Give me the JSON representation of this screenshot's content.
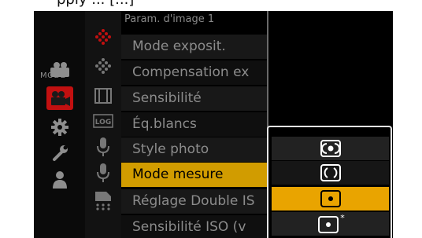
{
  "top_strip_text": "pply ... [...]",
  "menu": {
    "header": "Param. d'image 1",
    "items": [
      {
        "label": "Mode exposit."
      },
      {
        "label": "Compensation ex"
      },
      {
        "label": "Sensibilité"
      },
      {
        "label": "Éq.blancs"
      },
      {
        "label": "Style photo"
      },
      {
        "label": "Mode mesure"
      },
      {
        "label": "Réglage Double IS"
      },
      {
        "label": "Sensibilité ISO (v"
      }
    ],
    "selected_index": 5
  },
  "tabs": {
    "mode_label": "MODE"
  },
  "popup": {
    "options": [
      {
        "icon": "multi-metering-icon"
      },
      {
        "icon": "center-weighted-metering-icon"
      },
      {
        "icon": "spot-metering-icon"
      },
      {
        "icon": "highlight-weighted-metering-icon",
        "marker": "*"
      }
    ],
    "selected_index": 2
  },
  "colors": {
    "screen_bg": "#000000",
    "menu_text": "#8c8c8c",
    "menu_selected_bg": "#d19c00",
    "popup_selected_bg": "#e9a400",
    "tab_accent": "#cc1111"
  }
}
